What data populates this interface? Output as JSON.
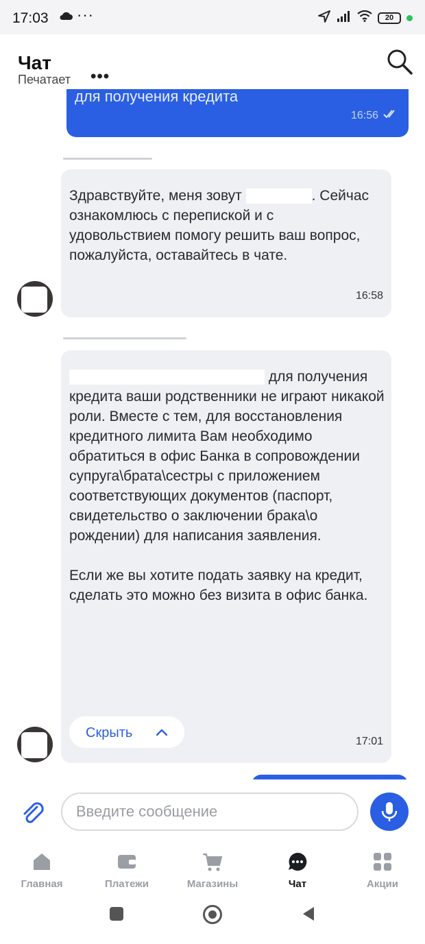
{
  "status_bar": {
    "time": "17:03",
    "battery": "20"
  },
  "header": {
    "title": "Чат",
    "subtitle": "Печатает"
  },
  "messages": [
    {
      "direction": "out",
      "text": "для получения кредита",
      "time": "16:56"
    },
    {
      "direction": "in",
      "text_before": "Здравствуйте, меня зовут ",
      "text_after": ". Сейчас ознакомлюсь с перепиской и с удовольствием помогу решить ваш вопрос, пожалуйста, оставайтесь в чате.",
      "time": "16:58"
    },
    {
      "direction": "in",
      "p1_tail": " для получения кредита ваши родственники не играют никакой роли. Вместе с тем, для восстановления кредитного лимита Вам необходимо обратиться в офис Банка в сопровождении супруга\\брата\\сестры с приложением соответствующих документов (паспорт, свидетельство о заключении брака\\о рождении) для написания заявления.",
      "p2": "Если же вы хотите подать заявку на кредит, сделать это можно без визита в офис банка.",
      "hide_label": "Скрыть",
      "time": "17:01"
    }
  ],
  "composer": {
    "placeholder": "Введите сообщение"
  },
  "tabs": [
    {
      "label": "Главная",
      "icon": "home-icon"
    },
    {
      "label": "Платежи",
      "icon": "wallet-icon"
    },
    {
      "label": "Магазины",
      "icon": "cart-icon"
    },
    {
      "label": "Чат",
      "icon": "chat-icon",
      "active": true
    },
    {
      "label": "Акции",
      "icon": "grid-icon"
    }
  ],
  "colors": {
    "accent": "#2a5fe3",
    "bubble_in": "#eff0f4"
  }
}
